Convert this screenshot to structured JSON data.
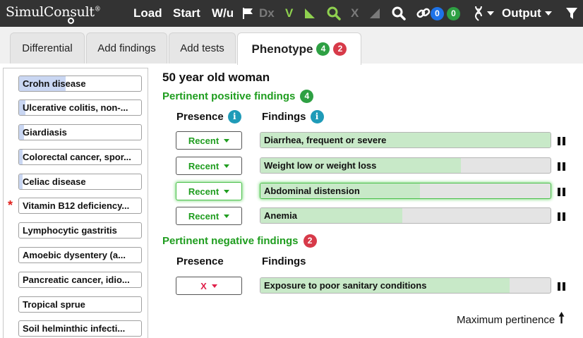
{
  "app": {
    "logo": "SimulConsult",
    "logo_tm": "®"
  },
  "toolbar": {
    "load": "Load",
    "start": "Start",
    "wu": "W/u",
    "dx": "Dx",
    "v": "V",
    "x": "X",
    "link_badge_blue": "0",
    "link_badge_green": "0",
    "output": "Output"
  },
  "tabs": [
    {
      "label": "Differential"
    },
    {
      "label": "Add findings"
    },
    {
      "label": "Add tests"
    },
    {
      "label": "Phenotype",
      "badge_green": "4",
      "badge_red": "2"
    }
  ],
  "sidebar": {
    "diagnoses": [
      {
        "label": "Crohn disease",
        "fill": 0.38
      },
      {
        "label": "Ulcerative colitis, non-...",
        "fill": 0.05
      },
      {
        "label": "Giardiasis",
        "fill": 0.04
      },
      {
        "label": "Colorectal cancer, spor...",
        "fill": 0.03
      },
      {
        "label": "Celiac disease",
        "fill": 0.03
      },
      {
        "label": "Vitamin B12 deficiency...",
        "fill": 0.0,
        "flagged": true,
        "flag_symbol": "*"
      },
      {
        "label": "Lymphocytic gastritis",
        "fill": 0.0
      },
      {
        "label": "Amoebic dysentery (a...",
        "fill": 0.0
      },
      {
        "label": "Pancreatic cancer, idio...",
        "fill": 0.0
      },
      {
        "label": "Tropical sprue",
        "fill": 0.0
      },
      {
        "label": "Soil helminthic infecti...",
        "fill": 0.0
      }
    ]
  },
  "main": {
    "patient": "50 year old woman",
    "positive": {
      "title": "Pertinent positive findings",
      "badge": "4",
      "presence_header": "Presence",
      "findings_header": "Findings",
      "rows": [
        {
          "presence": "Recent",
          "finding": "Diarrhea, frequent or severe",
          "pertinence": 1.0
        },
        {
          "presence": "Recent",
          "finding": "Weight low or weight loss",
          "pertinence": 0.69
        },
        {
          "presence": "Recent",
          "finding": "Abdominal distension",
          "pertinence": 0.55,
          "highlighted": true
        },
        {
          "presence": "Recent",
          "finding": "Anemia",
          "pertinence": 0.49
        }
      ]
    },
    "negative": {
      "title": "Pertinent negative findings",
      "badge": "2",
      "presence_header": "Presence",
      "findings_header": "Findings",
      "rows": [
        {
          "presence": "X",
          "finding": "Exposure to poor sanitary conditions",
          "pertinence": 0.86
        }
      ]
    },
    "legend": "Maximum pertinence"
  },
  "colors": {
    "topbar": "#333333",
    "positive_green": "#1f9d1f",
    "negative_red": "#e0204a",
    "fill_green": "#c8e9c8",
    "fill_blue": "#c9d6f2",
    "info_teal": "#1f9bb8"
  }
}
